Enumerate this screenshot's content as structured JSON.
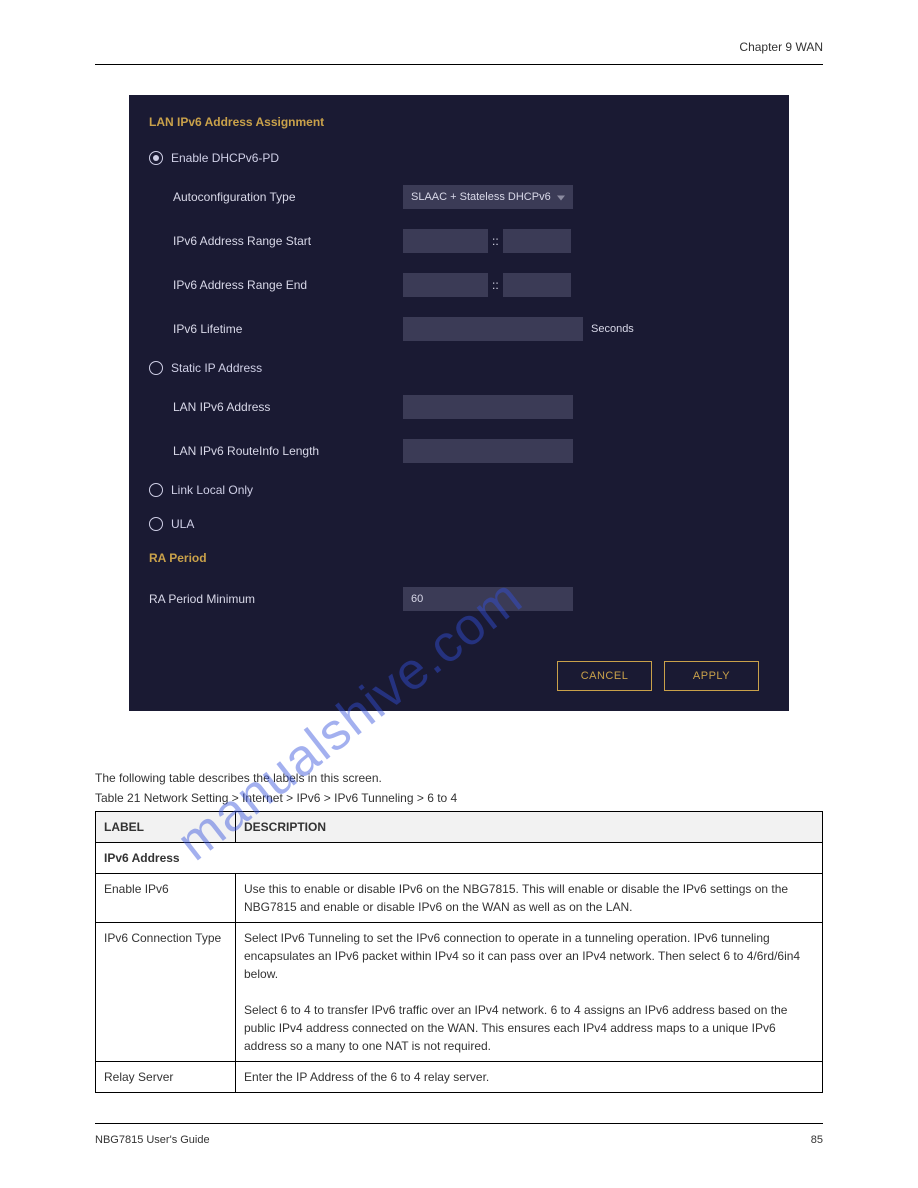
{
  "header": {
    "doc_title": "NBG7815 User's Guide",
    "chapter": "Chapter 9 WAN"
  },
  "panel": {
    "section1_title": "LAN IPv6 Address Assignment",
    "radio_dhcpv6pd": "Enable DHCPv6-PD",
    "autoconfig_label": "Autoconfiguration Type",
    "autoconfig_value": "SLAAC + Stateless DHCPv6",
    "range_start_label": "IPv6 Address Range Start",
    "range_end_label": "IPv6 Address Range End",
    "lifetime_label": "IPv6 Lifetime",
    "lifetime_suffix": "Seconds",
    "radio_static": "Static IP Address",
    "lan_ipv6_addr_label": "LAN IPv6 Address",
    "lan_ipv6_route_label": "LAN IPv6 RouteInfo Length",
    "radio_linklocal": "Link Local Only",
    "radio_ula": "ULA",
    "section2_title": "RA Period",
    "ra_period_min_label": "RA Period Minimum",
    "ra_period_min_value": "60",
    "btn_cancel": "CANCEL",
    "btn_apply": "APPLY"
  },
  "table": {
    "caption": "The following table describes the labels in this screen.",
    "table_title": "Table 21   Network Setting > Internet > IPv6 > IPv6 Tunneling > 6 to 4",
    "col_label": "LABEL",
    "col_desc": "DESCRIPTION",
    "section_header": "IPv6 Address",
    "rows": [
      {
        "label": "Enable IPv6",
        "desc": "Use this to enable or disable IPv6 on the NBG7815. This will enable or disable the IPv6 settings on the NBG7815 and enable or disable IPv6 on the WAN as well as on the LAN."
      },
      {
        "label": "IPv6 Connection Type",
        "desc": "Select IPv6 Tunneling to set the IPv6 connection to operate in a tunneling operation. IPv6 tunneling encapsulates an IPv6 packet within IPv4 so it can pass over an IPv4 network. Then select 6 to 4/6rd/6in4 below.\n\nSelect 6 to 4 to transfer IPv6 traffic over an IPv4 network. 6 to 4 assigns an IPv6 address based on the public IPv4 address connected on the WAN. This ensures each IPv4 address maps to a unique IPv6 address so a many to one NAT is not required."
      },
      {
        "label": "Relay Server",
        "desc": "Enter the IP Address of the 6 to 4 relay server."
      }
    ]
  },
  "footer": {
    "page": "85"
  },
  "watermark": "manualshive.com"
}
